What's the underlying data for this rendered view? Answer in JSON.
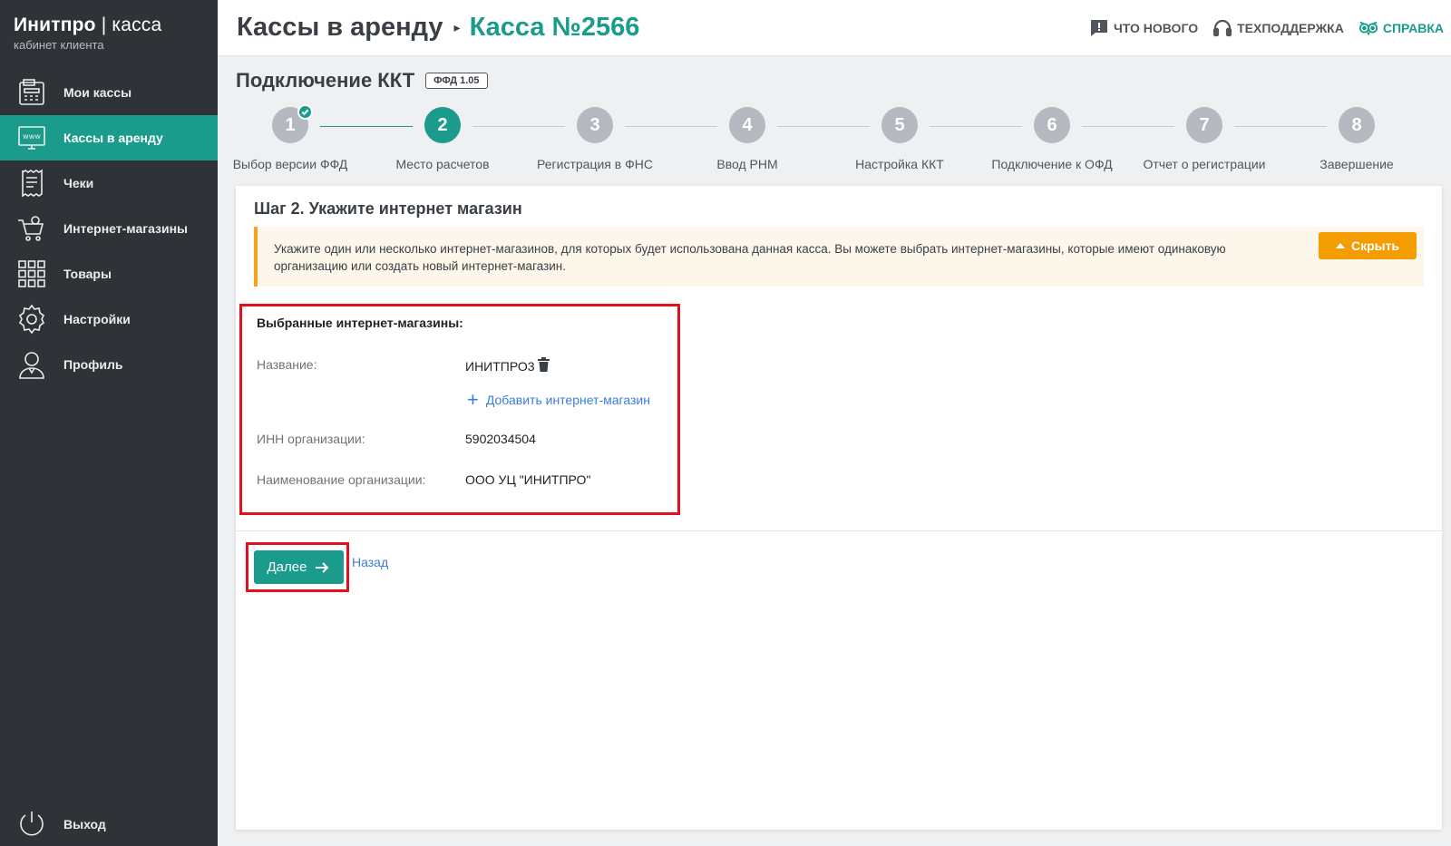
{
  "brand": {
    "name": "Инитпро",
    "product": "касса",
    "subtitle": "кабинет клиента"
  },
  "nav": [
    {
      "label": "Мои кассы",
      "icon": "cash-register-icon",
      "active": false
    },
    {
      "label": "Кассы в аренду",
      "icon": "www-monitor-icon",
      "active": true
    },
    {
      "label": "Чеки",
      "icon": "receipt-icon",
      "active": false
    },
    {
      "label": "Интернет-магазины",
      "icon": "shopping-cart-icon",
      "active": false
    },
    {
      "label": "Товары",
      "icon": "grid-icon",
      "active": false
    },
    {
      "label": "Настройки",
      "icon": "gear-icon",
      "active": false
    },
    {
      "label": "Профиль",
      "icon": "user-icon",
      "active": false
    }
  ],
  "logout": {
    "label": "Выход",
    "icon": "power-icon"
  },
  "header": {
    "parent": "Кассы в аренду",
    "current": "Касса №2566",
    "links": [
      {
        "label": "Что нового",
        "icon": "chat-alert-icon"
      },
      {
        "label": "Техподдержка",
        "icon": "headset-icon"
      },
      {
        "label": "Справка",
        "icon": "owl-icon"
      }
    ]
  },
  "page": {
    "title": "Подключение ККТ",
    "badge": "ФФД 1.05"
  },
  "steps": [
    {
      "number": "1",
      "label": "Выбор версии ФФД",
      "state": "done"
    },
    {
      "number": "2",
      "label": "Место расчетов",
      "state": "current"
    },
    {
      "number": "3",
      "label": "Регистрация в ФНС",
      "state": "pending"
    },
    {
      "number": "4",
      "label": "Ввод РНМ",
      "state": "pending"
    },
    {
      "number": "5",
      "label": "Настройка ККТ",
      "state": "pending"
    },
    {
      "number": "6",
      "label": "Подключение к ОФД",
      "state": "pending"
    },
    {
      "number": "7",
      "label": "Отчет о регистрации",
      "state": "pending"
    },
    {
      "number": "8",
      "label": "Завершение",
      "state": "pending"
    }
  ],
  "card": {
    "title": "Шаг 2. Укажите интернет магазин",
    "notice": "Укажите один или несколько интернет-магазинов, для которых будет использована данная касса. Вы можете выбрать интернет-магазины, которые имеют одинаковую организацию или создать новый интернет-магазин.",
    "hide_label": "Скрыть",
    "selected": {
      "title": "Выбранные интернет-магазины:",
      "name_label": "Название:",
      "name_value": "ИНИТПРО3",
      "add_label": "Добавить интернет-магазин",
      "inn_label": "ИНН организации:",
      "inn_value": "5902034504",
      "org_label": "Наименование организации:",
      "org_value": "ООО УЦ \"ИНИТПРО\""
    },
    "next_label": "Далее",
    "back_label": "Назад"
  },
  "colors": {
    "accent": "#1a9b8c",
    "sidebar": "#2f3338",
    "warning": "#f59c00",
    "highlight": "#e3101d",
    "link": "#3c7dd8"
  }
}
